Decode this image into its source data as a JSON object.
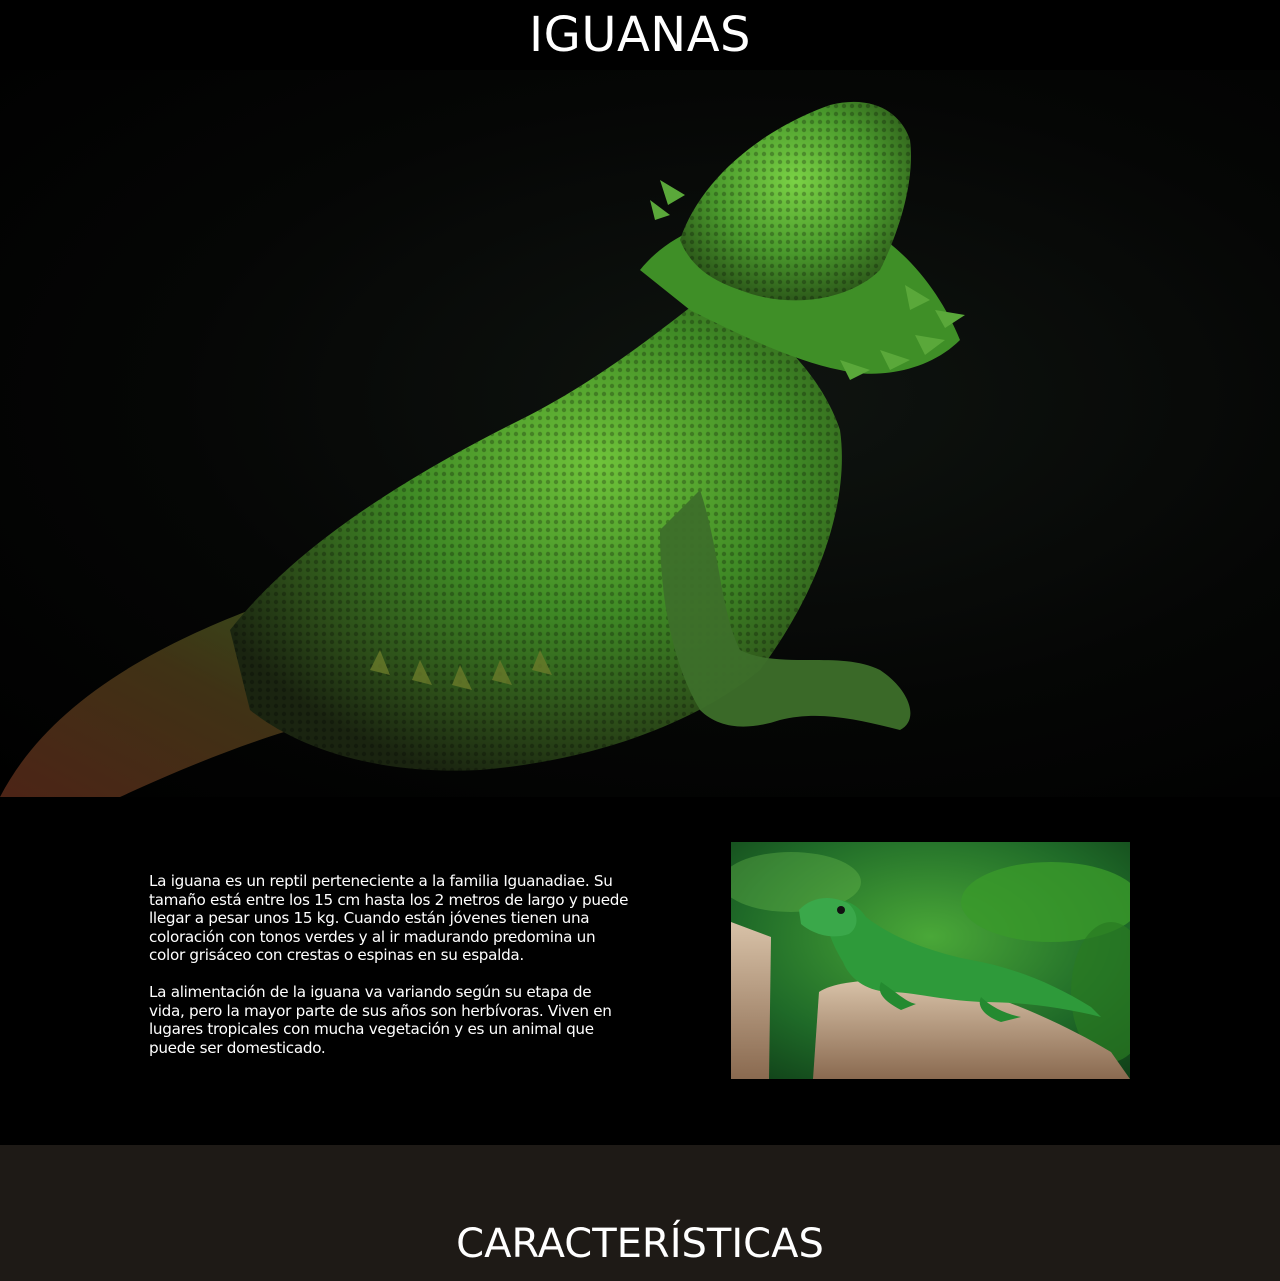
{
  "header": {
    "title": "IGUANAS"
  },
  "hero": {
    "image": "green-lizard-photo"
  },
  "intro": {
    "paragraphs": [
      "La iguana es un reptil perteneciente a la familia Iguanadiae. Su tamaño está entre los 15 cm hasta los 2 metros de largo y puede llegar a pesar unos 15 kg. Cuando están jóvenes tienen una coloración con tonos verdes y al ir madurando predomina un color grisáceo con crestas o espinas en su espalda.",
      "La alimentación de la iguana va variando según su etapa de vida, pero la mayor parte de sus años son herbívoras. Viven en lugares tropicales con mucha vegetación y es un animal que puede ser domesticado."
    ],
    "photo": "iguana-on-stump-photo"
  },
  "section": {
    "title": "CARACTERÍSTICAS"
  },
  "colors": {
    "background": "#000000",
    "section_background": "#1e1a16",
    "text": "#ffffff",
    "lizard_green": "#4e9a2e"
  }
}
